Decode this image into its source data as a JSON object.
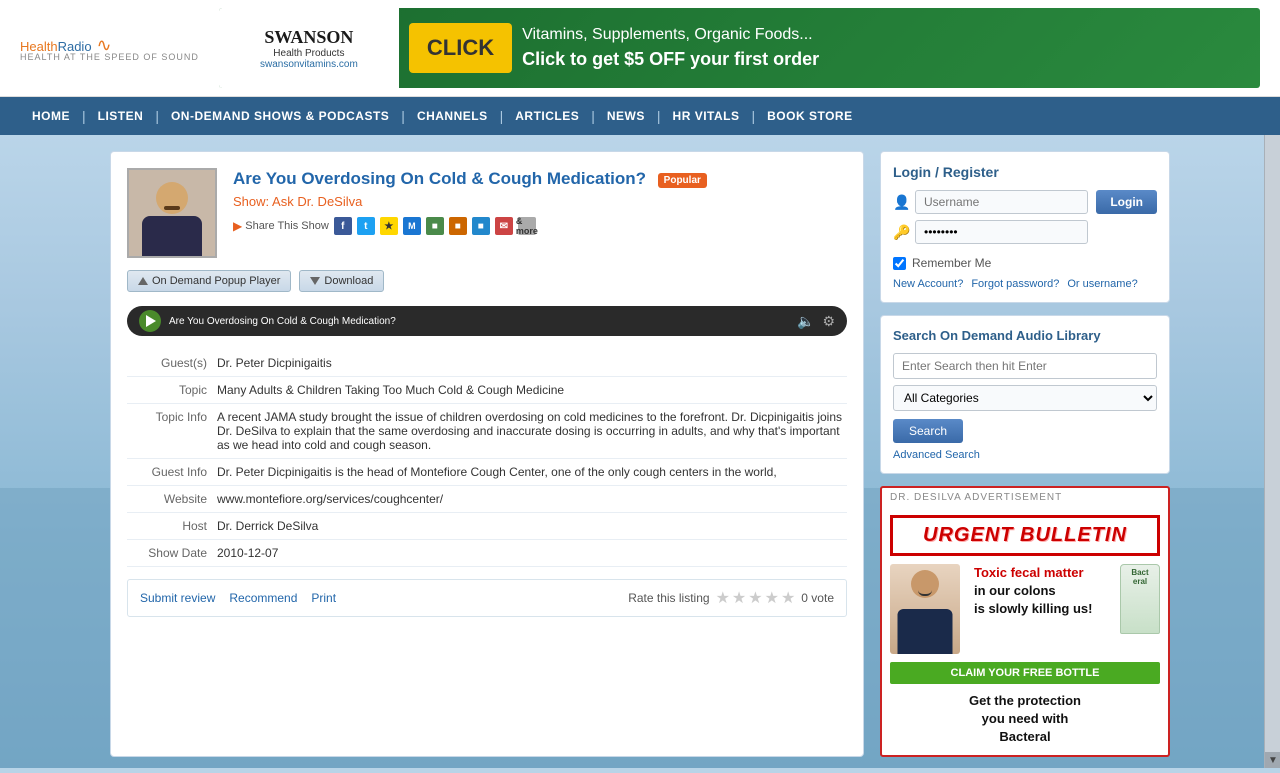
{
  "site": {
    "logo": {
      "health": "Health",
      "radio": "Radio",
      "tagline": "HEALTH AT THE SPEED OF SOUND",
      "signal": "))))"
    },
    "banner": {
      "brand": "SWANSON",
      "sub": "Health Products",
      "url": "swansonvitamins.com",
      "click": "CLICK",
      "headline": "Vitamins, Supplements, Organic Foods...",
      "cta": "Click to get $5 OFF your first order"
    }
  },
  "nav": {
    "items": [
      "HOME",
      "LISTEN",
      "ON-DEMAND SHOWS & PODCASTS",
      "CHANNELS",
      "ARTICLES",
      "NEWS",
      "HR VITALS",
      "BOOK STORE"
    ]
  },
  "show": {
    "title": "Are You Overdosing On Cold & Cough Medication?",
    "popular_badge": "Popular",
    "show_label": "Show:",
    "show_name": "Ask Dr. DeSilva",
    "share_label": "Share This Show",
    "more_label": "& more",
    "btn_ondemand": "On Demand Popup Player",
    "btn_download": "Download",
    "audio_title": "Are You Overdosing On Cold & Cough Medication?",
    "guests_label": "Guest(s)",
    "guests_value": "Dr. Peter Dicpinigaitis",
    "topic_label": "Topic",
    "topic_value": "Many Adults & Children Taking Too Much Cold & Cough Medicine",
    "topic_info_label": "Topic Info",
    "topic_info_value": "A recent JAMA study brought the issue of children overdosing on cold medicines to the forefront. Dr. Dicpinigaitis joins Dr. DeSilva to explain that the same overdosing and inaccurate dosing is occurring in adults, and why that's important as we head into cold and cough season.",
    "guest_info_label": "Guest Info",
    "guest_info_value": "Dr. Peter Dicpinigaitis is the head of Montefiore Cough Center, one of the only cough centers in the world,",
    "website_label": "Website",
    "website_value": "www.montefiore.org/services/coughcenter/",
    "host_label": "Host",
    "host_value": "Dr. Derrick DeSilva",
    "date_label": "Show Date",
    "date_value": "2010-12-07",
    "submit_review": "Submit review",
    "recommend": "Recommend",
    "print": "Print",
    "rate_label": "Rate this listing",
    "vote_label": "0 vote"
  },
  "login": {
    "title": "Login / Register",
    "username_placeholder": "Username",
    "password_placeholder": "········",
    "login_btn": "Login",
    "remember": "Remember Me",
    "new_account": "New Account?",
    "forgot_password": "Forgot password?",
    "or_username": "Or username?"
  },
  "search": {
    "title": "Search On Demand Audio Library",
    "input_placeholder": "Enter Search then hit Enter",
    "category_default": "All Categories",
    "search_btn": "Search",
    "advanced": "Advanced Search"
  },
  "ad": {
    "label": "DR. DESILVA ADVERTISEMENT",
    "urgent": "URGENT BULLETIN",
    "toxic": "Toxic fecal matter",
    "copy2": "in our colons",
    "copy3": "is slowly killing us!",
    "claim": "CLAIM YOUR FREE BOTTLE",
    "bottom1": "Get the protection",
    "bottom2": "you need with",
    "bottom3": "Bacteral"
  }
}
